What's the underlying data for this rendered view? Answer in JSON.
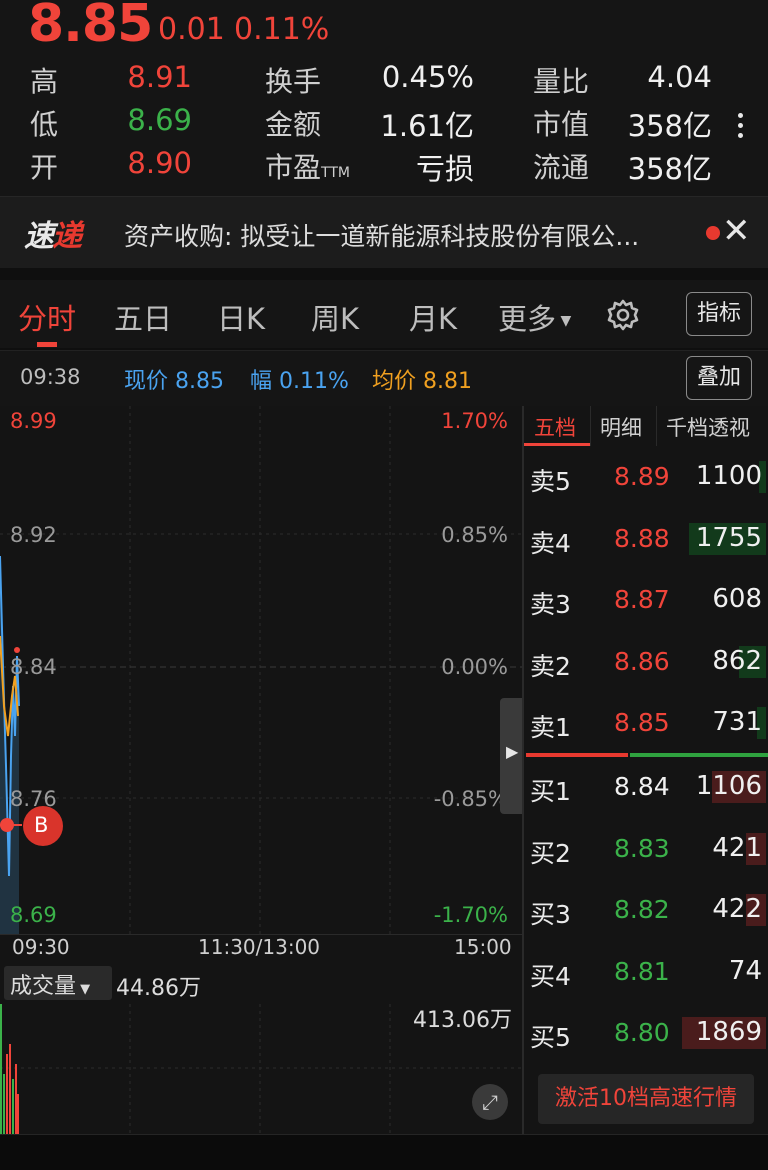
{
  "header": {
    "price": "8.85",
    "change": "0.01",
    "change_pct": "0.11%",
    "stats": {
      "high_label": "高",
      "high_value": "8.91",
      "low_label": "低",
      "low_value": "8.69",
      "open_label": "开",
      "open_value": "8.90",
      "turnover_label": "换手",
      "turnover_value": "0.45%",
      "amount_label": "金额",
      "amount_value": "1.61亿",
      "pe_label": "市盈",
      "pe_suffix": "TTM",
      "pe_value": "亏损",
      "volratio_label": "量比",
      "volratio_value": "4.04",
      "mktcap_label": "市值",
      "mktcap_value": "358亿",
      "float_label": "流通",
      "float_value": "358亿"
    }
  },
  "news": {
    "logo_a": "速",
    "logo_b": "递",
    "text": "资产收购: 拟受让一道新能源科技股份有限公..."
  },
  "tabs": {
    "items": [
      "分时",
      "五日",
      "日K",
      "周K",
      "月K",
      "更多"
    ],
    "indicator_label": "指标",
    "overlay_label": "叠加"
  },
  "quote": {
    "time": "09:38",
    "price_label": "现价",
    "price_value": "8.85",
    "range_label": "幅",
    "range_value": "0.11%",
    "avg_label": "均价",
    "avg_value": "8.81"
  },
  "chart": {
    "y_left": [
      "8.99",
      "8.92",
      "8.84",
      "8.76",
      "8.69"
    ],
    "y_right": [
      "1.70%",
      "0.85%",
      "0.00%",
      "-0.85%",
      "-1.70%"
    ],
    "x_ticks": [
      "09:30",
      "11:30/13:00",
      "15:00"
    ],
    "marker": "B"
  },
  "volume": {
    "label": "成交量",
    "current": "44.86万",
    "max": "413.06万"
  },
  "orderbook": {
    "tabs": [
      "五档",
      "明细",
      "千档透视"
    ],
    "asks": [
      {
        "label": "卖5",
        "price": "8.89",
        "vol": "1100",
        "frac": 0.08
      },
      {
        "label": "卖4",
        "price": "8.88",
        "vol": "1755",
        "frac": 0.86
      },
      {
        "label": "卖3",
        "price": "8.87",
        "vol": "608",
        "frac": 0.0
      },
      {
        "label": "卖2",
        "price": "8.86",
        "vol": "862",
        "frac": 0.3
      },
      {
        "label": "卖1",
        "price": "8.85",
        "vol": "731",
        "frac": 0.1
      }
    ],
    "bids": [
      {
        "label": "买1",
        "price": "8.84",
        "vol": "1106",
        "frac": 0.6
      },
      {
        "label": "买2",
        "price": "8.83",
        "vol": "421",
        "frac": 0.22
      },
      {
        "label": "买3",
        "price": "8.82",
        "vol": "422",
        "frac": 0.22
      },
      {
        "label": "买4",
        "price": "8.81",
        "vol": "74",
        "frac": 0.0
      },
      {
        "label": "买5",
        "price": "8.80",
        "vol": "1869",
        "frac": 0.93
      }
    ],
    "activate_label": "激活10档高速行情"
  },
  "colors": {
    "up": "#f0443a",
    "down": "#3bb24a",
    "avg": "#f0a020",
    "price_line": "#4aa3f0"
  }
}
